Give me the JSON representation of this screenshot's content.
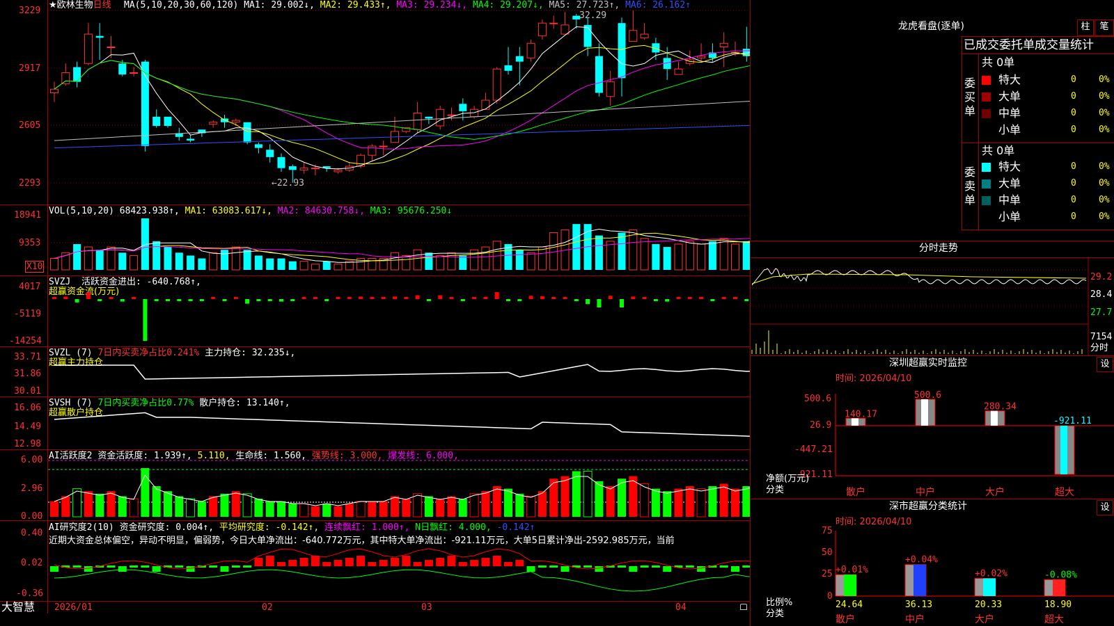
{
  "stock": {
    "star": "★",
    "name": "欧林生物",
    "period": "日线"
  },
  "ma_line": {
    "label": "MA(5,10,20,30,60,120)",
    "items": [
      {
        "text": "MA1: 29.002↓,",
        "color": "#ffffff"
      },
      {
        "text": "MA2: 29.433↑,",
        "color": "#ffff00"
      },
      {
        "text": "MA3: 29.234↓,",
        "color": "#ff00ff"
      },
      {
        "text": "MA4: 29.207↓,",
        "color": "#00ff00"
      },
      {
        "text": "MA5: 27.723↑,",
        "color": "#c0c0c0"
      },
      {
        "text": "MA6: 26.162↑",
        "color": "#3050ff"
      }
    ]
  },
  "price_axis": [
    "3229",
    "2917",
    "2605",
    "2293"
  ],
  "price_annotations": {
    "high": "32.29",
    "low": "←22.93"
  },
  "vol": {
    "label": "VOL(5,10,20)",
    "value": "68423.938↑,",
    "ma1": "MA1: 63083.617↓,",
    "ma2": "MA2: 84630.758↓,",
    "ma3": "MA3: 95676.250↓",
    "axis": [
      "18941",
      "9353"
    ],
    "unit": "X10"
  },
  "svzj": {
    "label": "SVZJ",
    "value": "活跃资金进出: -640.768↑,",
    "subtitle": "超赢资金流(万元)",
    "axis": [
      "4017",
      "-5119",
      "-14254"
    ]
  },
  "svzl": {
    "label": "SVZL (7)",
    "ratio": "7日内买卖净占比0.241%",
    "hold": "主力持仓: 32.235↓,",
    "subtitle": "超赢主力持仓",
    "axis": [
      "33.71",
      "31.86",
      "30.01"
    ]
  },
  "svsh": {
    "label": "SVSH (7)",
    "ratio": "7日内买卖净占比0.77%",
    "hold": "散户持仓: 13.140↑,",
    "subtitle": "超赢散户持仓",
    "axis": [
      "16.06",
      "14.49",
      "12.98"
    ]
  },
  "ai1": {
    "label": "AI活跃度2",
    "v1": "资金活跃度: 1.939↑,",
    "v2": "5.110,",
    "v3": "生命线: 1.560,",
    "v4": "强势线: 3.000,",
    "v5": "爆发线: 6.000,",
    "axis": [
      "6.00",
      "2.96",
      "0.00"
    ]
  },
  "ai2": {
    "label": "AI研究度2(10)",
    "v1": "资金研究度: 0.004↑,",
    "v2": "平均研究度: -0.142↑,",
    "v3": "连续飘红: 1.000↑,",
    "v4": "N日飘红: 4.000,",
    "v5": "-0.142↑",
    "axis": [
      "0.40",
      "0.02",
      "-0.36"
    ],
    "commentary": "近期大资金总体偏空，异动不明显，偏弱势，今日大单净流出：-640.772万元，其中特大单净流出：-921.11万元，大单5日累计净出-2592.985万元，当前"
  },
  "date_axis": [
    "2026/01",
    "02",
    "03",
    "04"
  ],
  "brand": "大智慧",
  "right": {
    "lhb_title": "龙虎看盘(逐单)",
    "btn_bar": "柱",
    "btn_bi": "笔",
    "stats_header": "已成交委托单成交量统计",
    "buy": {
      "side_label": "委买单",
      "total": "共 0单",
      "rows": [
        {
          "name": "特大",
          "count": "0",
          "pct": "0%",
          "color": "#ff0000"
        },
        {
          "name": "大单",
          "count": "0",
          "pct": "0%",
          "color": "#a00000"
        },
        {
          "name": "中单",
          "count": "0",
          "pct": "0%",
          "color": "#700000"
        },
        {
          "name": "小单",
          "count": "0",
          "pct": "0%",
          "color": "#000000"
        }
      ]
    },
    "sell": {
      "side_label": "委卖单",
      "total": "共 0单",
      "rows": [
        {
          "name": "特大",
          "count": "0",
          "pct": "0%",
          "color": "#00ffff"
        },
        {
          "name": "大单",
          "count": "0",
          "pct": "0%",
          "color": "#008080"
        },
        {
          "name": "中单",
          "count": "0",
          "pct": "0%",
          "color": "#006060"
        },
        {
          "name": "小单",
          "count": "0",
          "pct": "0%",
          "color": "#000000"
        }
      ]
    },
    "intraday": {
      "title": "分时走势",
      "axis": [
        "29.2",
        "28.4",
        "27.7"
      ],
      "vol": "7154",
      "vol_unit": "分时"
    },
    "sz_monitor": {
      "title": "深圳超赢实时监控",
      "btn": "设",
      "date": "时间: 2026/04/10",
      "axis": [
        "500.6",
        "26.9",
        "-447.21",
        "-921.11"
      ],
      "ylabel": "净额(万元)",
      "xlabel": "分类",
      "bars": [
        {
          "name": "散户",
          "value": 140.17,
          "label": "140.17",
          "color": "#ffffff"
        },
        {
          "name": "中户",
          "value": 500.6,
          "label": "500.6",
          "color": "#ffffff"
        },
        {
          "name": "大户",
          "value": 280.34,
          "label": "280.34",
          "color": "#ffffff"
        },
        {
          "name": "超大",
          "value": -921.11,
          "label": "-921.11",
          "color": "#00ffff"
        }
      ]
    },
    "sz_class": {
      "title": "深市超赢分类统计",
      "btn": "设",
      "date": "时间: 2026/04/10",
      "axis": [
        "75",
        "50",
        "25",
        "0"
      ],
      "ylabel": "比例%",
      "xlabel": "分类",
      "bars": [
        {
          "name": "散户",
          "value": 24.64,
          "label": "24.64",
          "delta": "+0.01%",
          "color": "#00ff00"
        },
        {
          "name": "中户",
          "value": 36.13,
          "label": "36.13",
          "delta": "+0.04%",
          "color": "#2040ff"
        },
        {
          "name": "大户",
          "value": 20.33,
          "label": "20.33",
          "delta": "+0.02%",
          "color": "#00ffff"
        },
        {
          "name": "超大",
          "value": 18.9,
          "label": "18.90",
          "delta": "-0.08%",
          "color": "#ff2020"
        }
      ]
    }
  },
  "chart_data": {
    "type": "candlestick",
    "candles": [
      [
        27.8,
        28.0,
        27.3,
        28.4
      ],
      [
        28.3,
        28.9,
        28.2,
        29.4
      ],
      [
        29.2,
        28.4,
        28.1,
        29.5
      ],
      [
        29.4,
        31.0,
        29.3,
        31.6
      ],
      [
        30.9,
        30.8,
        29.6,
        31.6
      ],
      [
        30.3,
        30.3,
        29.7,
        30.9
      ],
      [
        29.4,
        28.8,
        28.7,
        29.6
      ],
      [
        28.9,
        28.9,
        28.7,
        29.2
      ],
      [
        29.5,
        24.9,
        24.6,
        29.6
      ],
      [
        26.5,
        26.0,
        25.9,
        26.9
      ],
      [
        26.5,
        26.0,
        25.9,
        26.4
      ],
      [
        25.6,
        25.4,
        25.2,
        25.9
      ],
      [
        25.3,
        25.2,
        25.1,
        25.5
      ],
      [
        25.8,
        25.6,
        25.4,
        25.8
      ],
      [
        26.1,
        26.2,
        25.9,
        26.3
      ],
      [
        26.4,
        26.2,
        25.9,
        26.6
      ],
      [
        26.2,
        26.3,
        26.0,
        26.4
      ],
      [
        26.2,
        25.1,
        25.0,
        26.2
      ],
      [
        25.0,
        24.8,
        24.5,
        25.1
      ],
      [
        24.7,
        24.3,
        24.0,
        25.0
      ],
      [
        24.3,
        23.7,
        23.5,
        24.5
      ],
      [
        23.8,
        23.6,
        22.9,
        23.9
      ],
      [
        23.6,
        23.7,
        23.4,
        24.0
      ],
      [
        23.7,
        23.7,
        23.3,
        23.9
      ],
      [
        23.8,
        23.7,
        23.5,
        23.8
      ],
      [
        23.5,
        23.6,
        23.4,
        23.7
      ],
      [
        23.6,
        23.8,
        23.5,
        24.0
      ],
      [
        23.8,
        24.4,
        23.7,
        24.5
      ],
      [
        24.4,
        24.9,
        24.1,
        25.0
      ],
      [
        24.9,
        24.9,
        24.4,
        25.2
      ],
      [
        25.1,
        25.7,
        25.1,
        26.5
      ],
      [
        25.7,
        25.9,
        25.6,
        25.9
      ],
      [
        25.8,
        26.7,
        25.6,
        27.3
      ],
      [
        26.5,
        26.4,
        26.1,
        26.5
      ],
      [
        26.0,
        26.9,
        25.8,
        27.1
      ],
      [
        26.6,
        26.6,
        26.3,
        27.0
      ],
      [
        27.2,
        26.8,
        26.3,
        27.5
      ],
      [
        26.5,
        26.9,
        26.4,
        27.1
      ],
      [
        26.9,
        27.4,
        26.9,
        27.8
      ],
      [
        27.4,
        29.1,
        27.2,
        29.2
      ],
      [
        29.3,
        29.0,
        28.8,
        30.3
      ],
      [
        29.8,
        29.5,
        28.2,
        30.3
      ],
      [
        29.7,
        30.5,
        29.5,
        30.7
      ],
      [
        30.9,
        31.6,
        30.7,
        31.8
      ],
      [
        31.6,
        31.6,
        31.3,
        32.0
      ],
      [
        31.0,
        31.5,
        31.2,
        32.2
      ],
      [
        32.0,
        31.8,
        31.3,
        32.1
      ],
      [
        31.5,
        30.3,
        29.8,
        31.9
      ],
      [
        29.8,
        27.8,
        27.6,
        30.5
      ],
      [
        27.6,
        28.4,
        27.1,
        29.0
      ],
      [
        31.6,
        28.6,
        27.6,
        31.9
      ],
      [
        30.6,
        31.2,
        31.0,
        32.3
      ],
      [
        30.8,
        31.0,
        30.7,
        31.6
      ],
      [
        30.5,
        30.0,
        29.6,
        30.8
      ],
      [
        29.7,
        29.1,
        28.5,
        30.3
      ],
      [
        28.8,
        29.1,
        28.9,
        29.5
      ],
      [
        29.4,
        29.6,
        29.3,
        30.1
      ],
      [
        29.7,
        29.8,
        29.5,
        30.5
      ],
      [
        30.0,
        29.7,
        29.5,
        30.5
      ],
      [
        30.3,
        30.5,
        29.2,
        31.1
      ],
      [
        30.0,
        30.0,
        29.8,
        30.6
      ],
      [
        30.2,
        29.8,
        29.5,
        31.4
      ],
      [
        29.8,
        30.7,
        29.9,
        30.9
      ],
      [
        30.4,
        30.6,
        30.3,
        31.0
      ],
      [
        30.2,
        30.2,
        30.0,
        30.3
      ],
      [
        30.2,
        29.9,
        29.6,
        30.5
      ],
      [
        29.9,
        29.8,
        29.6,
        30.4
      ],
      [
        29.7,
        29.6,
        29.6,
        30.2
      ],
      [
        29.8,
        29.7,
        29.4,
        30.4
      ],
      [
        29.5,
        29.7,
        29.2,
        29.9
      ],
      [
        29.9,
        29.2,
        29.1,
        30.0
      ],
      [
        29.6,
        29.7,
        29.5,
        30.6
      ]
    ],
    "volumes": [
      4,
      6,
      9,
      8,
      7,
      8,
      6,
      5,
      18,
      10,
      8,
      6,
      5,
      4,
      6,
      7,
      8,
      7,
      5,
      4,
      4,
      3,
      3,
      2,
      3,
      2,
      3,
      4,
      4,
      4,
      6,
      5,
      7,
      6,
      5,
      6,
      5,
      7,
      8,
      10,
      9,
      7,
      6,
      8,
      13,
      14,
      16,
      16,
      12,
      10,
      13,
      14,
      11,
      9,
      8,
      9,
      10,
      9,
      10,
      11,
      9,
      10,
      12,
      9,
      8,
      7,
      8,
      7,
      6,
      5,
      5,
      6
    ],
    "date_labels": [
      "2026/01",
      "02",
      "03",
      "04"
    ]
  }
}
